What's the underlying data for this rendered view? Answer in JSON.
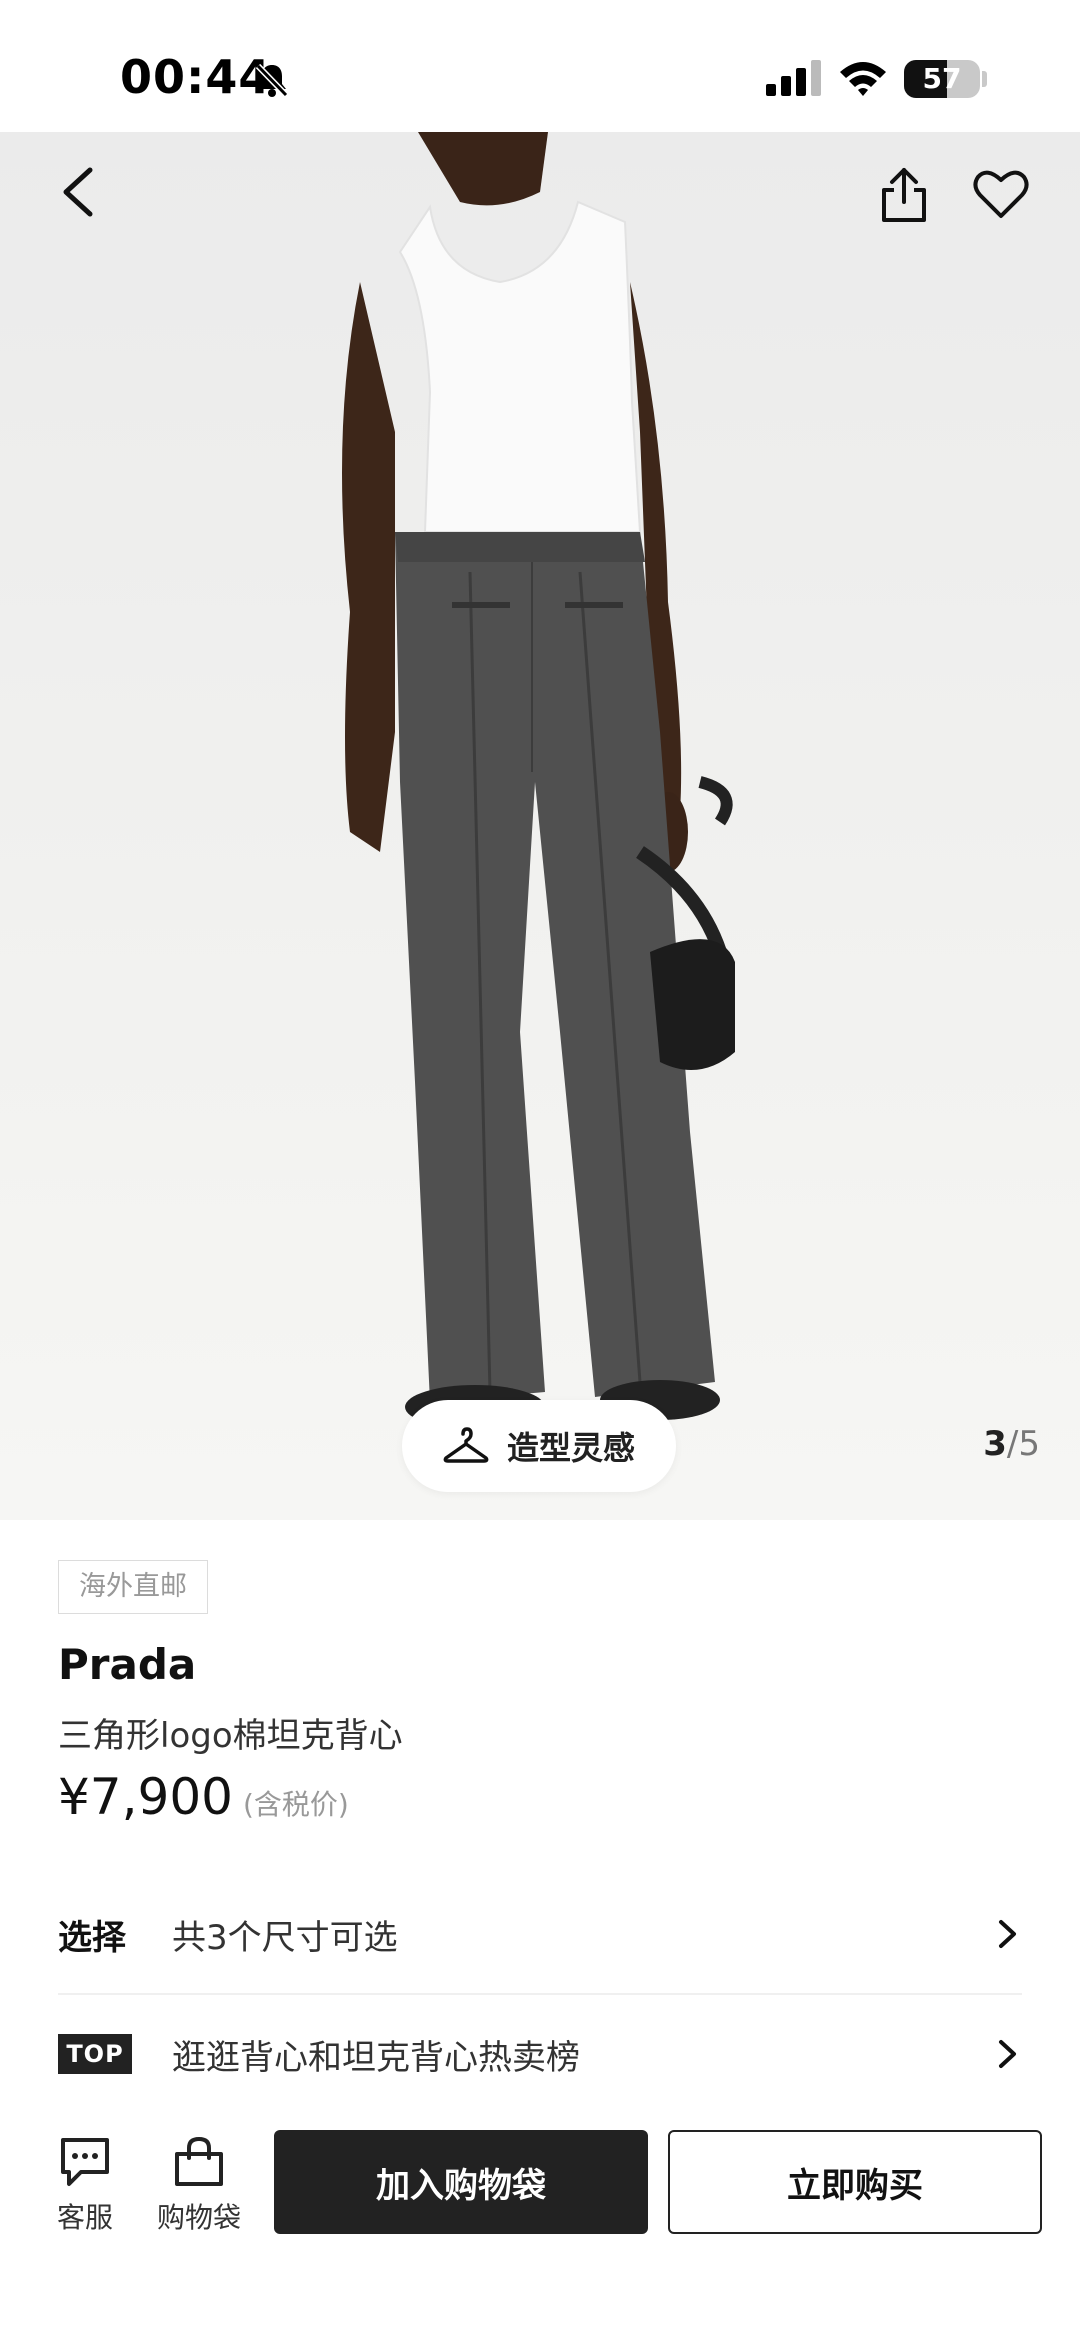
{
  "status_bar": {
    "time": "00:44",
    "battery_level": "57",
    "battery_fraction": 0.57,
    "icons": [
      "bell-muted-icon",
      "signal-icon",
      "wifi-icon",
      "battery-icon"
    ]
  },
  "hero": {
    "style_button_label": "造型灵感",
    "page_current": "3",
    "page_separator": "/",
    "page_total": "5",
    "icons": [
      "back-arrow-icon",
      "share-icon",
      "heart-icon",
      "hanger-icon"
    ]
  },
  "product": {
    "tag": "海外直邮",
    "brand": "Prada",
    "name": "三角形logo棉坦克背心",
    "price": "¥7,900",
    "price_note": "(含税价)"
  },
  "options": {
    "select_title": "选择",
    "select_text": "共3个尺寸可选",
    "top_badge": "TOP",
    "rank_text": "逛逛背心和坦克背心热卖榜"
  },
  "bottom_bar": {
    "service_label": "客服",
    "bag_label": "购物袋",
    "add_to_bag_label": "加入购物袋",
    "buy_now_label": "立即购买"
  },
  "colors": {
    "dark_button": "#222222",
    "background": "#ffffff",
    "muted_text": "#999999"
  }
}
